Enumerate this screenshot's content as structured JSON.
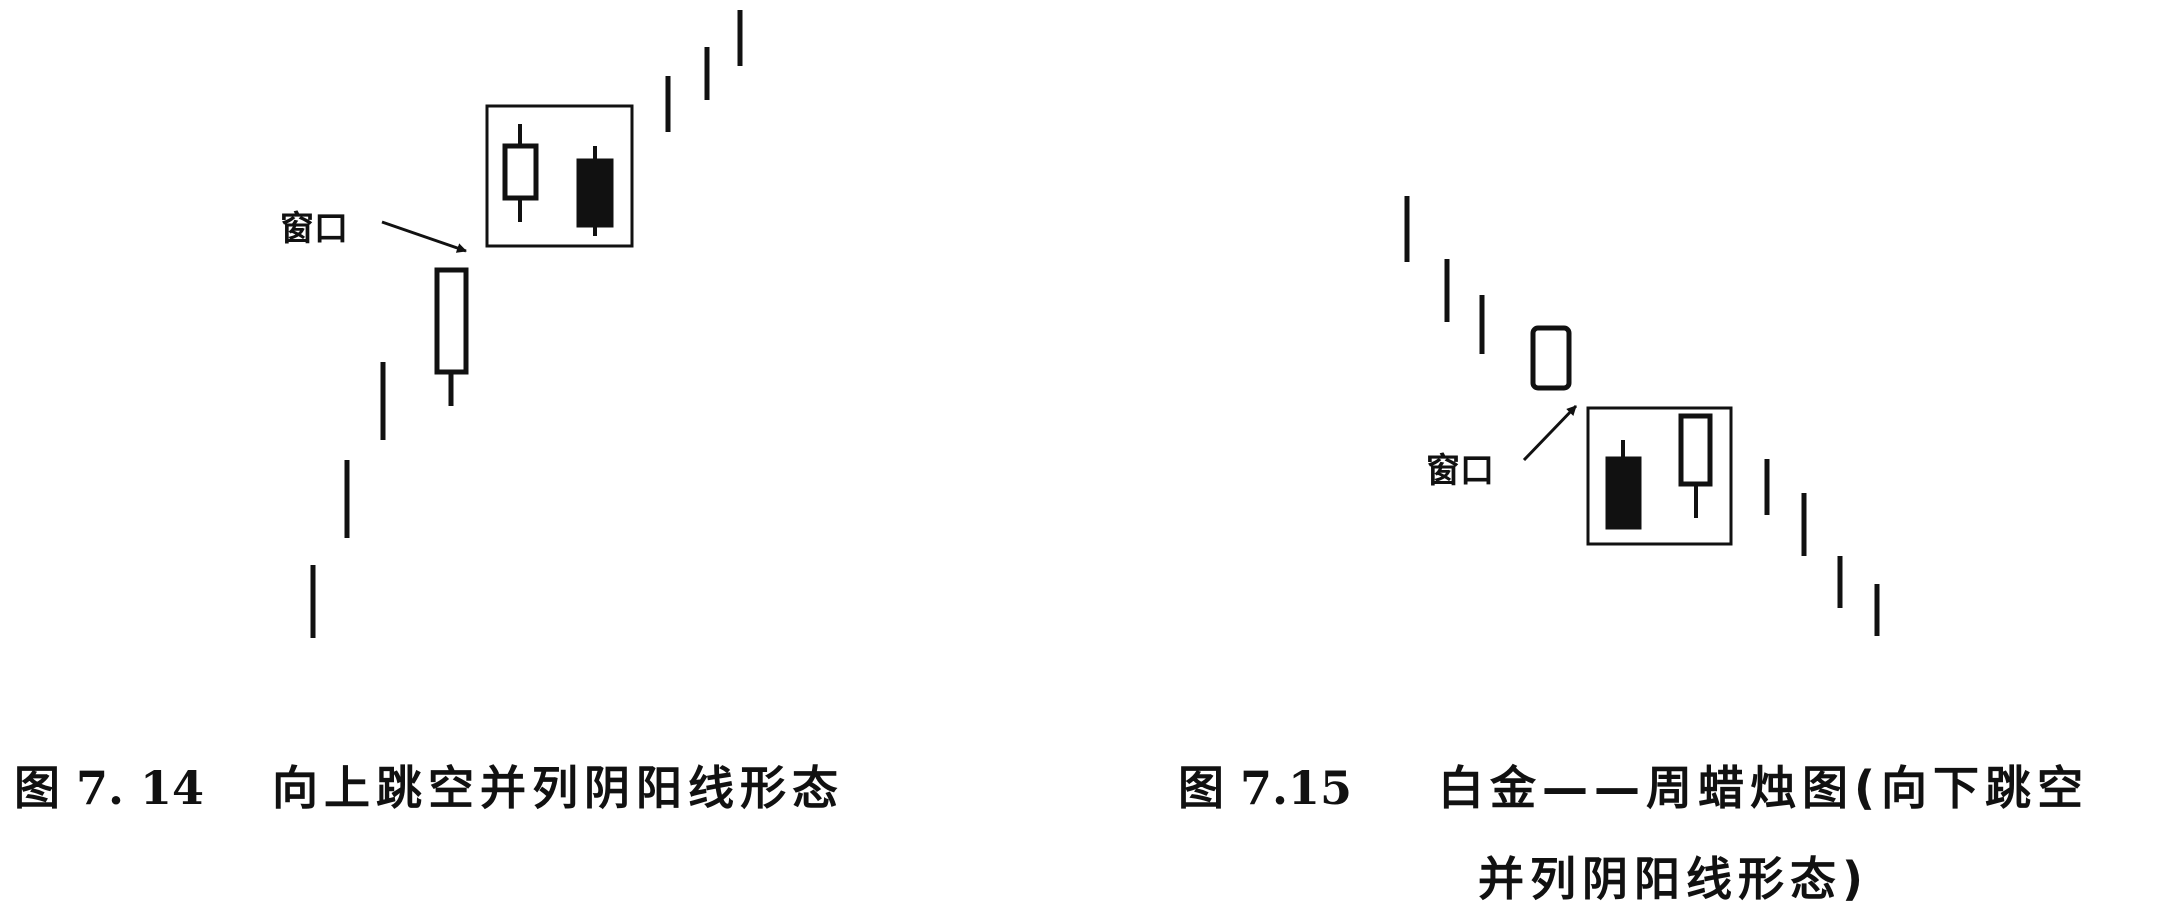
{
  "figures": [
    {
      "number": "图 7. 14",
      "caption_lines": [
        "向上跳空并列阴阳线形态"
      ],
      "annotation": "窗口"
    },
    {
      "number": "图 7.15",
      "caption_lines": [
        "白金——周蜡烛图(向下跳空",
        "并列阴阳线形态)"
      ],
      "annotation": "窗口"
    }
  ],
  "colors": {
    "ink": "#111111",
    "background": "#ffffff"
  }
}
